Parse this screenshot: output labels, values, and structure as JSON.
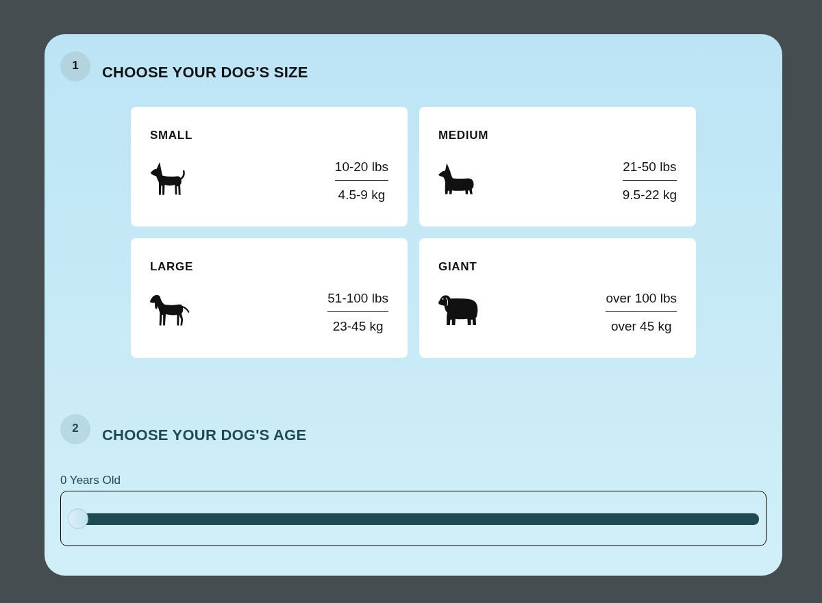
{
  "size_step": {
    "number": "1",
    "heading": "CHOOSE YOUR DOG'S SIZE",
    "options": [
      {
        "label": "SMALL",
        "weight_lbs": "10-20 lbs",
        "weight_kg": "4.5-9 kg",
        "selected": false
      },
      {
        "label": "MEDIUM",
        "weight_lbs": "21-50 lbs",
        "weight_kg": "9.5-22 kg",
        "selected": false
      },
      {
        "label": "LARGE",
        "weight_lbs": "51-100 lbs",
        "weight_kg": "23-45 kg",
        "selected": false
      },
      {
        "label": "GIANT",
        "weight_lbs": "over 100 lbs",
        "weight_kg": "over 45 kg",
        "selected": false
      }
    ]
  },
  "age_step": {
    "number": "2",
    "heading": "CHOOSE YOUR DOG'S AGE",
    "reading": "0 Years Old",
    "level": 0
  }
}
